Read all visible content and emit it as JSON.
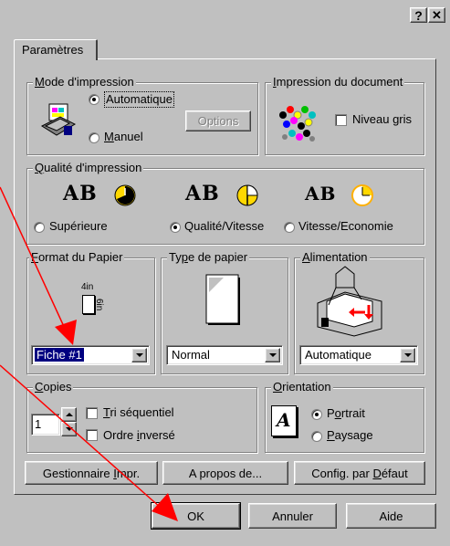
{
  "titlebar": {
    "help_label": "?",
    "close_label": "✕"
  },
  "tab": {
    "label": "Paramètres"
  },
  "mode": {
    "title_key": "M",
    "title_rest": "ode d'impression",
    "auto_label": "Automatique",
    "manual_key": "M",
    "manual_rest": "anuel",
    "options_label": "Options"
  },
  "doc": {
    "title_key": "I",
    "title_rest": "mpression du document",
    "gray_label": "Niveau gris"
  },
  "quality": {
    "title_key": "Q",
    "title_rest": "ualité d'impression",
    "ab_text": "AB",
    "superior_label": "Supérieure",
    "qv_label": "Qualité/Vitesse",
    "ve_label": "Vitesse/Economie"
  },
  "format": {
    "title_key": "F",
    "title_rest": "ormat du Papier",
    "width_label": "4in",
    "height_label": "6in",
    "value": "Fiche #1"
  },
  "paper": {
    "title_pre": "Ty",
    "title_key": "p",
    "title_rest": "e de papier",
    "value": "Normal"
  },
  "feed": {
    "title_key": "A",
    "title_rest": "limentation",
    "value": "Automatique"
  },
  "copies": {
    "title_key": "C",
    "title_rest": "opies",
    "count": "1",
    "collate_key": "T",
    "collate_rest": "ri séquentiel",
    "reverse_pre": "Ordre ",
    "reverse_key": "i",
    "reverse_rest": "nversé"
  },
  "orientation": {
    "title_key": "O",
    "title_rest": "rientation",
    "icon_letter": "A",
    "portrait_pre": "P",
    "portrait_key": "o",
    "portrait_rest": "rtrait",
    "landscape_key": "P",
    "landscape_rest": "aysage"
  },
  "bottom_buttons": {
    "manager_pre": "Gestionnaire ",
    "manager_key": "I",
    "manager_rest": "mpr.",
    "about_label": "A propos de...",
    "default_pre": "Config. par ",
    "default_key": "D",
    "default_rest": "éfaut"
  },
  "dialog_buttons": {
    "ok": "OK",
    "cancel": "Annuler",
    "help": "Aide"
  },
  "colors": {
    "annotation_red": "#ff0000",
    "selection_blue": "#000080",
    "face": "#c0c0c0"
  }
}
